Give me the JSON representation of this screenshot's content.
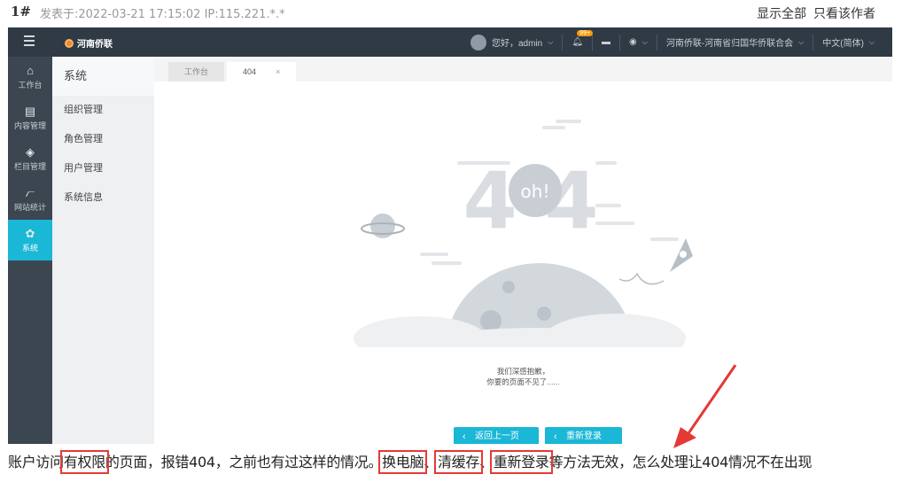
{
  "post": {
    "floor": "1#",
    "meta": "发表于:2022-03-21 17:15:02  IP:115.221.*.*",
    "show_all": "显示全部",
    "author_only": "只看该作者"
  },
  "app": {
    "logo_text": "河南侨联",
    "greeting": "您好，admin",
    "notif_badge": "99+",
    "org": "河南侨联-河南省归国华侨联合会",
    "lang": "中文(简体)"
  },
  "leftnav": [
    {
      "icon": "home-icon",
      "glyph": "⌂",
      "label": "工作台"
    },
    {
      "icon": "document-icon",
      "glyph": "▤",
      "label": "内容管理"
    },
    {
      "icon": "layers-icon",
      "glyph": "◈",
      "label": "栏目管理"
    },
    {
      "icon": "chart-icon",
      "glyph": "⦧",
      "label": "网站统计"
    },
    {
      "icon": "gear-icon",
      "glyph": "✿",
      "label": "系统"
    }
  ],
  "subnav": {
    "title": "系统",
    "items": [
      "组织管理",
      "角色管理",
      "用户管理",
      "系统信息"
    ]
  },
  "tabs": [
    {
      "label": "工作台"
    },
    {
      "label": "404",
      "close": "×"
    }
  ],
  "error": {
    "bubble": "oh!",
    "big": "404",
    "line1": "我们深感抱歉，",
    "line2": "你要的页面不见了......",
    "back_btn": "返回上一页",
    "relogin_btn": "重新登录"
  },
  "caption": {
    "p1": "账户访问",
    "h1": "有权限",
    "p2": "的页面，报错404，之前也有过这样的情况。",
    "h2": "换电脑",
    "p3": "、",
    "h3": "清缓存",
    "p4": "、",
    "h4": "重新登录",
    "p5": "等方法无效，怎么处理让404情况不在出现"
  },
  "colors": {
    "accent": "#1ab7d6",
    "topbar": "#2f3a45",
    "highlight": "#e53935"
  }
}
